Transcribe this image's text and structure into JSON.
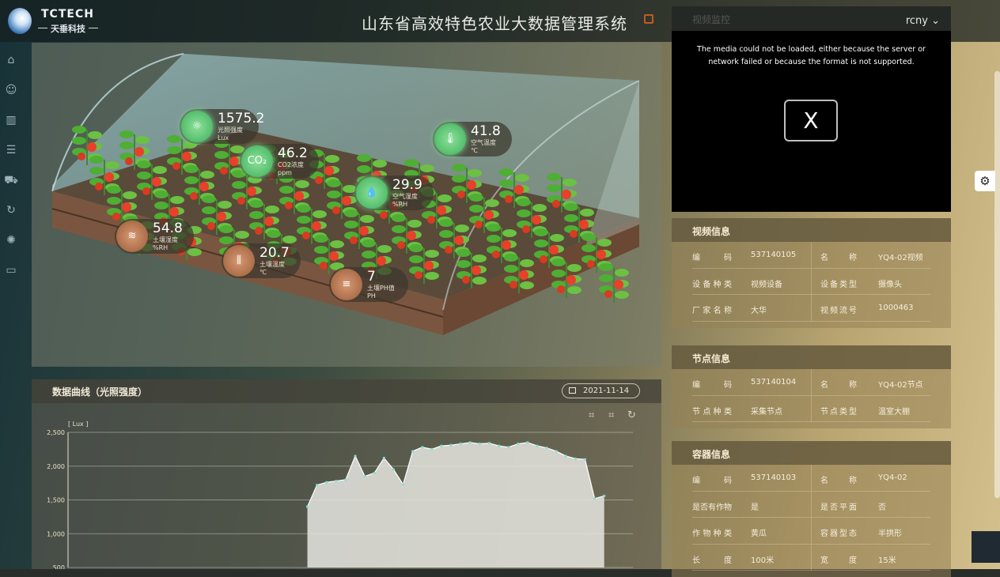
{
  "header": {
    "brand_en": "TCTECH",
    "brand_cn": "天垂科技",
    "title": "山东省高效特色农业大数据管理系统"
  },
  "sidebar": {
    "items": [
      "home-icon",
      "user-icon",
      "bar-chart-icon",
      "list-icon",
      "truck-icon",
      "refresh-icon",
      "bug-icon",
      "video-icon"
    ]
  },
  "sensors": [
    {
      "value": "1575.2",
      "name": "光照强度",
      "unit": "Lux",
      "icon": "sun-icon",
      "style": "g"
    },
    {
      "value": "46.2",
      "name": "CO2浓度",
      "unit": "ppm",
      "icon": "co2-icon",
      "style": "g"
    },
    {
      "value": "41.8",
      "name": "空气温度",
      "unit": "℃",
      "icon": "thermometer-icon",
      "style": "g"
    },
    {
      "value": "29.9",
      "name": "空气湿度",
      "unit": "%RH",
      "icon": "droplet-icon",
      "style": "g"
    },
    {
      "value": "54.8",
      "name": "土壤湿度",
      "unit": "%RH",
      "icon": "soil-moisture-icon",
      "style": "b"
    },
    {
      "value": "20.7",
      "name": "土壤温度",
      "unit": "℃",
      "icon": "soil-temp-icon",
      "style": "b"
    },
    {
      "value": "7",
      "name": "土壤PH值",
      "unit": "PH",
      "icon": "ph-icon",
      "style": "b"
    }
  ],
  "chart_panel": {
    "title": "数据曲线（光照强度）",
    "date": "2021-11-14"
  },
  "chart_data": {
    "type": "area",
    "ylabel": "[ Lux ]",
    "ylim": [
      500,
      2500
    ],
    "yticks": [
      "2,500",
      "2,000",
      "1,500",
      "1,000",
      "500"
    ],
    "ytick_values": [
      2500,
      2000,
      1500,
      1000,
      500
    ],
    "x": [
      0,
      1,
      2,
      3,
      4,
      5,
      6,
      7,
      8,
      9,
      10,
      11,
      12,
      13,
      14,
      15,
      16,
      17,
      18,
      19,
      20,
      21,
      22,
      23,
      24,
      25,
      26,
      27,
      28,
      29,
      30,
      31,
      32,
      33,
      34,
      35,
      36,
      37,
      38,
      39,
      40,
      41,
      42,
      43,
      44,
      45,
      46,
      47,
      48,
      49,
      50,
      51,
      52,
      53,
      54,
      55,
      56,
      57,
      58,
      59
    ],
    "values": [
      null,
      null,
      null,
      null,
      null,
      null,
      null,
      null,
      null,
      null,
      null,
      null,
      null,
      null,
      null,
      null,
      null,
      null,
      null,
      null,
      null,
      null,
      null,
      null,
      null,
      1400,
      1720,
      1760,
      1780,
      1800,
      2150,
      1850,
      1900,
      2120,
      1950,
      1730,
      2220,
      2280,
      2250,
      2300,
      2310,
      2330,
      2350,
      2330,
      2340,
      2300,
      2280,
      2330,
      2350,
      2300,
      2270,
      2220,
      2150,
      2110,
      2100,
      1520,
      1560,
      null,
      null,
      null
    ]
  },
  "video": {
    "header": "视频监控",
    "user": "rcny",
    "message": "The media could not be loaded, either because the server or network failed or because the format is not supported.",
    "close_label": "X"
  },
  "panels": [
    {
      "title": "视频信息",
      "rows": [
        {
          "k1": "编码",
          "v1": "537140105",
          "k2": "名称",
          "v2": "YQ4-02视频"
        },
        {
          "k1": "设备种类",
          "v1": "视频设备",
          "k2": "设备类型",
          "v2": "摄像头"
        },
        {
          "k1": "厂家名称",
          "v1": "大华",
          "k2": "视频流号",
          "v2": "1000463"
        }
      ]
    },
    {
      "title": "节点信息",
      "rows": [
        {
          "k1": "编码",
          "v1": "537140104",
          "k2": "名称",
          "v2": "YQ4-02节点"
        },
        {
          "k1": "节点种类",
          "v1": "采集节点",
          "k2": "节点类型",
          "v2": "温室大棚"
        }
      ]
    },
    {
      "title": "容器信息",
      "rows": [
        {
          "k1": "编码",
          "v1": "537140103",
          "k2": "名称",
          "v2": "YQ4-02"
        },
        {
          "k1": "是否有作物",
          "v1": "是",
          "k2": "是否平面",
          "v2": "否"
        },
        {
          "k1": "作物种类",
          "v1": "黄瓜",
          "k2": "容器型态",
          "v2": "半拱形"
        },
        {
          "k1": "长度",
          "v1": "100米",
          "k2": "宽度",
          "v2": "15米"
        }
      ]
    }
  ]
}
